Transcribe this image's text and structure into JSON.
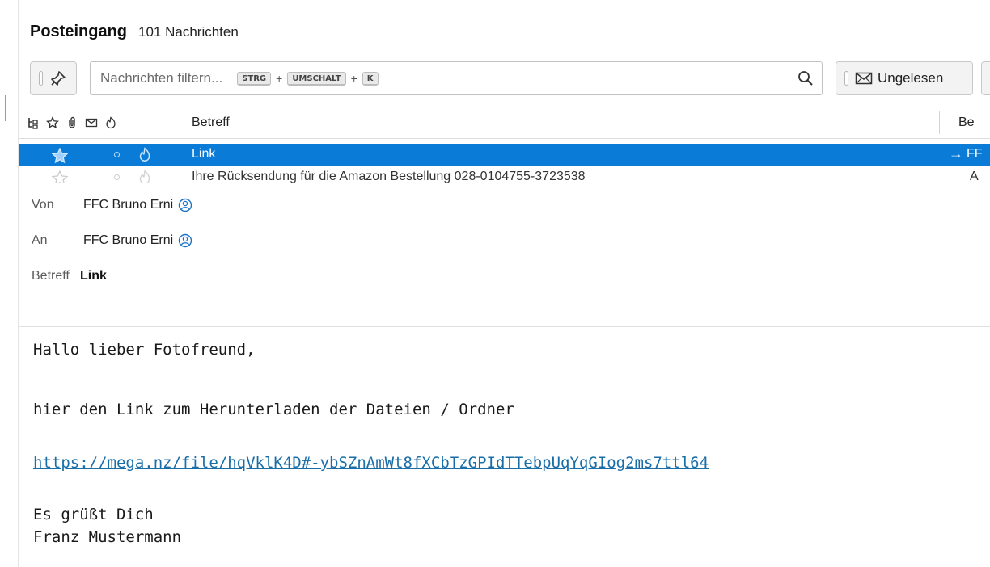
{
  "folder": {
    "name": "Posteingang",
    "count": "101 Nachrichten"
  },
  "quick_filter": {
    "placeholder": "Nachrichten filtern...",
    "shortcut_keys": [
      "STRG",
      "UMSCHALT",
      "K"
    ],
    "shortcut_plus": "+",
    "unread_label": "Ungelesen"
  },
  "columns": {
    "subject": "Betreff",
    "sender": "Be"
  },
  "messages": [
    {
      "subject": "Link",
      "sender": "FF",
      "selected": true
    },
    {
      "subject": "Ihre Rücksendung für die Amazon Bestellung 028-0104755-3723538",
      "sender": "A",
      "selected": false
    }
  ],
  "header": {
    "from_label": "Von",
    "from_value": "FFC Bruno Erni",
    "to_label": "An",
    "to_value": "FFC Bruno Erni",
    "subject_label": "Betreff",
    "subject_value": "Link"
  },
  "body": {
    "greeting": "Hallo lieber Fotofreund,",
    "line1": "hier den Link zum Herunterladen der Dateien / Ordner",
    "link": "https://mega.nz/file/hqVklK4D#-ybSZnAmWt8fXCbTzGPIdTTebpUqYqGIog2ms7ttl64",
    "closing": "Es grüßt Dich",
    "signature": "Franz Mustermann"
  },
  "colors": {
    "selection": "#0a7bd6",
    "link": "#1a6ea8"
  },
  "icons": [
    "pin-icon",
    "search-icon",
    "envelope-icon",
    "star-icon",
    "thread-icon",
    "attachment-icon",
    "junk-icon",
    "contact-icon"
  ]
}
